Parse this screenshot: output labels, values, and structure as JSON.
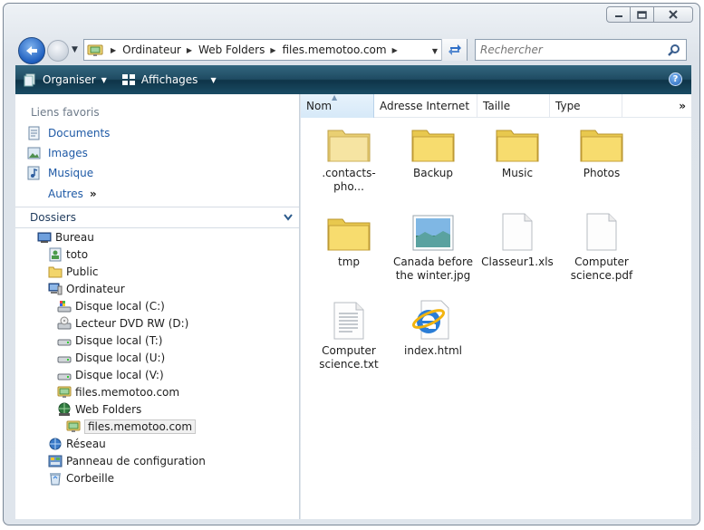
{
  "window": {
    "controls": [
      "minimize-icon",
      "maximize-icon",
      "close-icon"
    ]
  },
  "address": {
    "crumbs": [
      "Ordinateur",
      "Web Folders",
      "files.memotoo.com"
    ],
    "search_placeholder": "Rechercher"
  },
  "toolbar": {
    "organize_label": "Organiser",
    "views_label": "Affichages",
    "help_label": "?"
  },
  "favorites": {
    "title": "Liens favoris",
    "items": [
      "Documents",
      "Images",
      "Musique"
    ],
    "more_label": "Autres",
    "more_chevron": "»"
  },
  "folders": {
    "header": "Dossiers",
    "tree": [
      {
        "label": "Bureau",
        "icon": "desktop-icon"
      },
      {
        "label": "toto",
        "icon": "user-folder-icon"
      },
      {
        "label": "Public",
        "icon": "folder-icon"
      },
      {
        "label": "Ordinateur",
        "icon": "computer-icon"
      },
      {
        "label": "Disque local (C:)",
        "icon": "system-drive-icon"
      },
      {
        "label": "Lecteur DVD RW (D:)",
        "icon": "dvd-drive-icon"
      },
      {
        "label": "Disque local (T:)",
        "icon": "drive-icon"
      },
      {
        "label": "Disque local (U:)",
        "icon": "drive-icon"
      },
      {
        "label": "Disque local (V:)",
        "icon": "drive-icon"
      },
      {
        "label": "files.memotoo.com",
        "icon": "network-place-icon"
      },
      {
        "label": "Web Folders",
        "icon": "web-folders-icon"
      },
      {
        "label": "files.memotoo.com",
        "icon": "network-place-icon"
      },
      {
        "label": "Réseau",
        "icon": "network-icon"
      },
      {
        "label": "Panneau de configuration",
        "icon": "control-panel-icon"
      },
      {
        "label": "Corbeille",
        "icon": "recycle-bin-icon"
      }
    ]
  },
  "columns": [
    "Nom",
    "Adresse Internet",
    "Taille",
    "Type"
  ],
  "columns_more": "»",
  "files": [
    {
      "name": ".contacts-pho...",
      "icon": "folder-icon"
    },
    {
      "name": "Backup",
      "icon": "folder-icon"
    },
    {
      "name": "Music",
      "icon": "folder-icon"
    },
    {
      "name": "Photos",
      "icon": "folder-icon"
    },
    {
      "name": "tmp",
      "icon": "folder-icon"
    },
    {
      "name": "Canada before the winter.jpg",
      "icon": "image-file-icon"
    },
    {
      "name": "Classeur1.xls",
      "icon": "blank-file-icon"
    },
    {
      "name": "Computer science.pdf",
      "icon": "blank-file-icon"
    },
    {
      "name": "Computer science.txt",
      "icon": "text-file-icon"
    },
    {
      "name": "index.html",
      "icon": "ie-file-icon"
    }
  ],
  "colors": {
    "toolbar": "#1f4b62",
    "link": "#1f5aa6",
    "folder": "#f5d978"
  }
}
